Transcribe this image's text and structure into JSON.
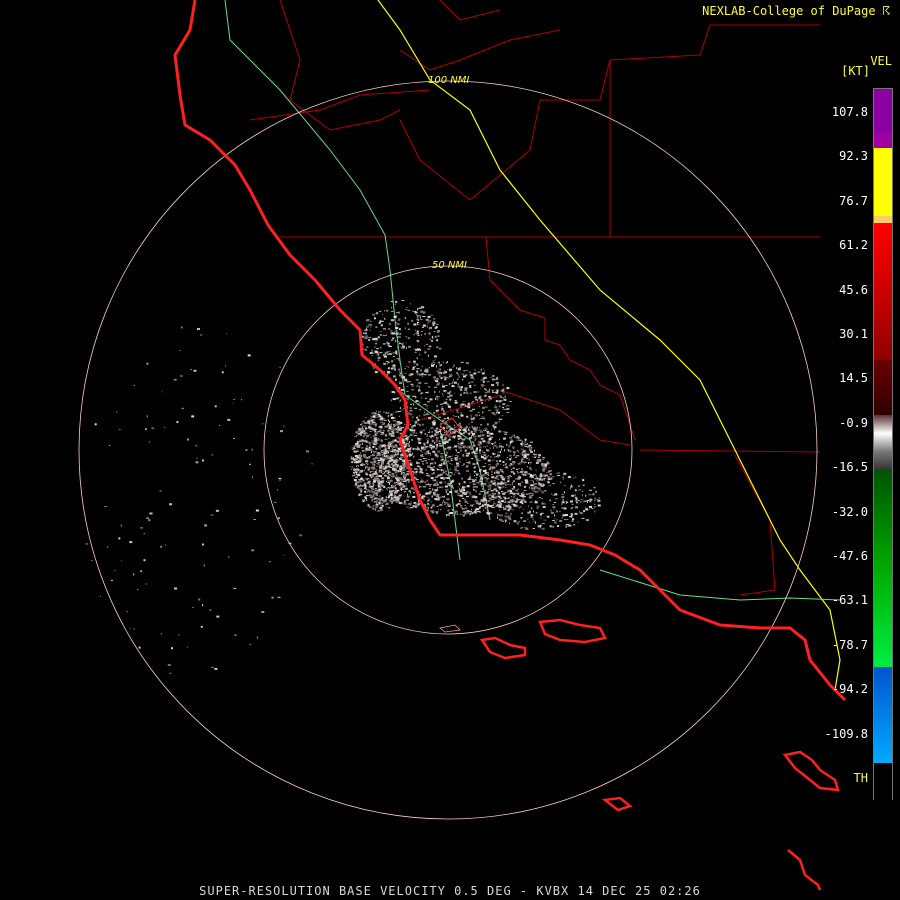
{
  "credit": "NEXLAB-College of DuPage ☈",
  "title": "SUPER-RESOLUTION BASE VELOCITY 0.5 DEG - KVBX 14 DEC 25 02:26",
  "rings": [
    {
      "label": "100 NMI"
    },
    {
      "label": "50 NMI"
    }
  ],
  "legend": {
    "product": "VEL",
    "units": "[KT]",
    "ticks": [
      "107.8",
      "92.3",
      "76.7",
      "61.2",
      "45.6",
      "30.1",
      "14.5",
      "-0.9",
      "-16.5",
      "-32.0",
      "-47.6",
      "-63.1",
      "-78.7",
      "-94.2",
      "-109.8",
      "TH"
    ]
  },
  "colors": {
    "coastline": "#ff2020",
    "county": "#b00000",
    "highway_major": "#ffff00",
    "highway_minor": "#66dd88",
    "ring": "#ffcccc",
    "echo": "#c8c0c0"
  }
}
